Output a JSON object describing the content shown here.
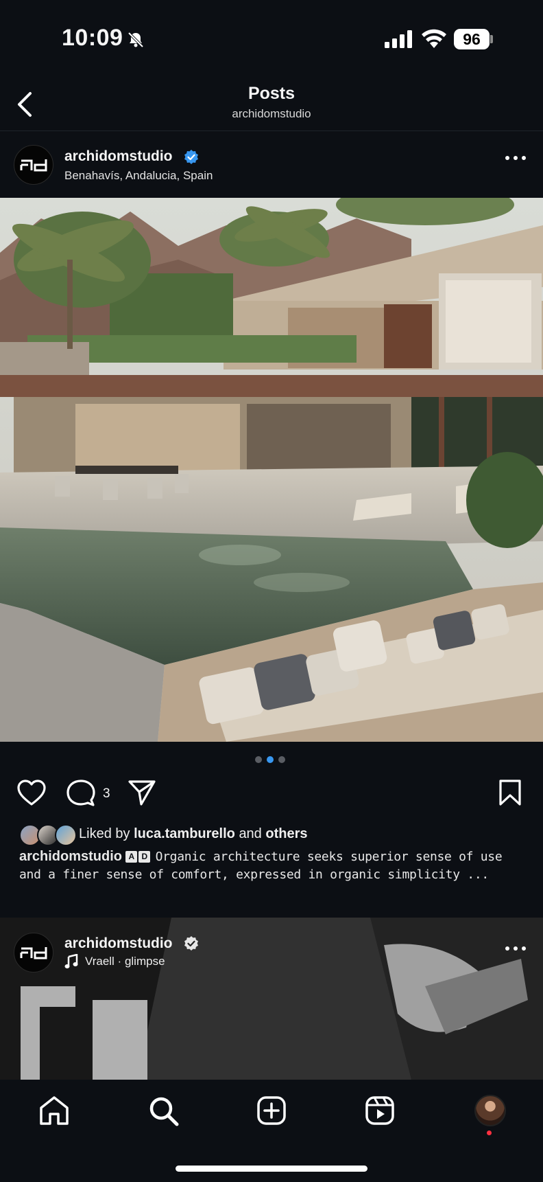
{
  "status_bar": {
    "time": "10:09",
    "battery": "96"
  },
  "header": {
    "title": "Posts",
    "subtitle": "archidomstudio"
  },
  "post1": {
    "username": "archidomstudio",
    "location": "Benahavís, Andalucia, Spain",
    "comment_count": "3",
    "carousel": {
      "count": 3,
      "active": 1
    },
    "liked_by_prefix": "Liked by",
    "liked_by_user": "luca.tamburello",
    "liked_by_and": "and",
    "liked_by_others": "others",
    "caption_user": "archidomstudio",
    "caption_badge": [
      "A",
      "D"
    ],
    "caption_text": "Organic architecture seeks superior sense of use and a finer sense of comfort, expressed in organic simplicity ..."
  },
  "post2": {
    "username": "archidomstudio",
    "audio": "Vraell · glimpse"
  },
  "nav": {
    "items": [
      "home-icon",
      "search-icon",
      "create-icon",
      "reels-icon",
      "profile-avatar"
    ]
  },
  "colors": {
    "background": "#0c0f14",
    "verified_blue": "#3897f0",
    "notification_red": "#ff3040"
  }
}
